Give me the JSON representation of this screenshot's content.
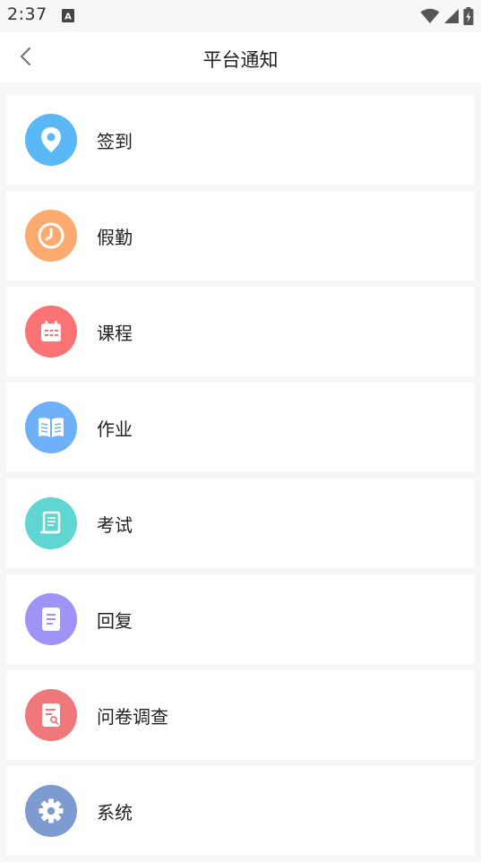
{
  "status_bar": {
    "time": "2:37",
    "app_icon_letter": "A"
  },
  "header": {
    "title": "平台通知",
    "back_icon": "chevron-left-icon"
  },
  "items": [
    {
      "label": "签到",
      "icon": "location-pin-icon",
      "color": "#5ab8f7"
    },
    {
      "label": "假勤",
      "icon": "clock-icon",
      "color": "#fdaa6e"
    },
    {
      "label": "课程",
      "icon": "calendar-icon",
      "color": "#fb7374"
    },
    {
      "label": "作业",
      "icon": "book-icon",
      "color": "#6eb0fa"
    },
    {
      "label": "考试",
      "icon": "scroll-icon",
      "color": "#5fd6d2"
    },
    {
      "label": "回复",
      "icon": "document-icon",
      "color": "#9e94f7"
    },
    {
      "label": "问卷调查",
      "icon": "survey-icon",
      "color": "#f0777a"
    },
    {
      "label": "系统",
      "icon": "gear-icon",
      "color": "#7e9bd1"
    }
  ]
}
